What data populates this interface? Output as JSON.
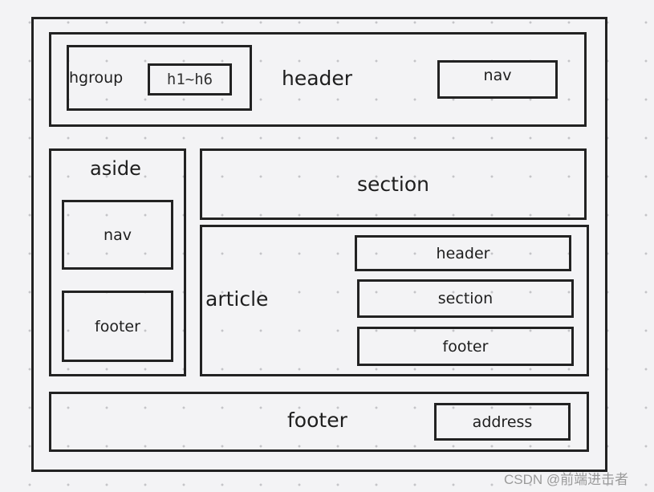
{
  "labels": {
    "hgroup": "hgroup",
    "h1_h6": "h1~h6",
    "header": "header",
    "header_nav": "nav",
    "aside": "aside",
    "aside_nav": "nav",
    "aside_footer": "footer",
    "section": "section",
    "article": "article",
    "article_header": "header",
    "article_section": "section",
    "article_footer": "footer",
    "footer": "footer",
    "address": "address"
  },
  "watermark": "CSDN @前端进击者"
}
